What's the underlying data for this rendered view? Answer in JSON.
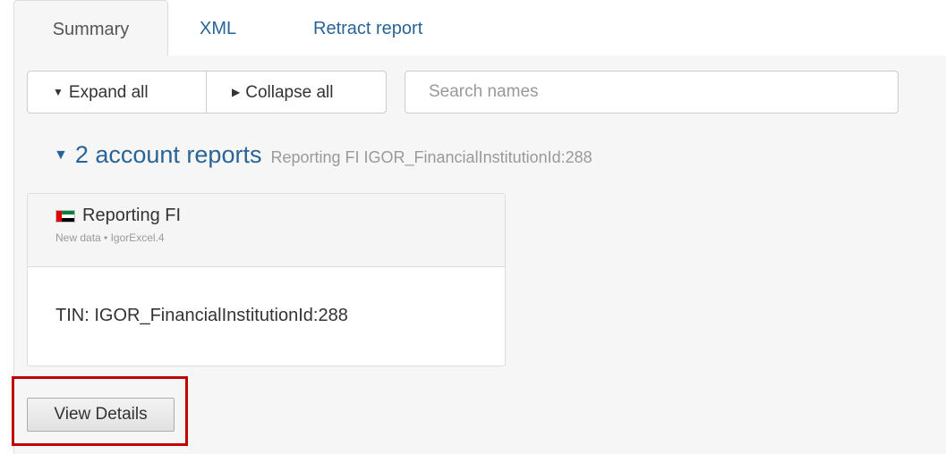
{
  "tabs": [
    {
      "label": "Summary",
      "active": true
    },
    {
      "label": "XML",
      "active": false
    },
    {
      "label": "Retract report",
      "active": false
    }
  ],
  "toolbar": {
    "expand_label": "Expand all",
    "collapse_label": "Collapse all",
    "expand_icon": "caret-down-icon",
    "collapse_icon": "caret-right-icon"
  },
  "search": {
    "placeholder": "Search names",
    "value": ""
  },
  "section": {
    "icon": "caret-down-icon",
    "title": "2 account reports",
    "subtitle": "Reporting FI IGOR_FinancialInstitutionId:288"
  },
  "card": {
    "flag_icon": "uae-flag-icon",
    "title": "Reporting FI",
    "meta": "New data • IgorExcel.4",
    "body": "TIN: IGOR_FinancialInstitutionId:288"
  },
  "actions": {
    "view_details_label": "View Details"
  },
  "colors": {
    "link": "#2a6496",
    "highlight": "#c00000",
    "panel_bg": "#f6f6f6"
  }
}
